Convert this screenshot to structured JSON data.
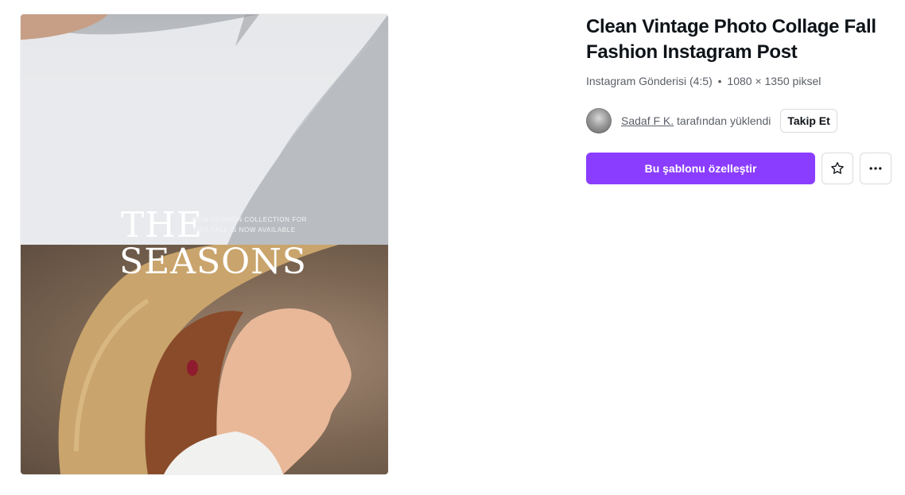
{
  "preview": {
    "image_top_description_icon": "white-hat-photo",
    "image_bottom_description_icon": "woman-straw-hat-photo",
    "title_line_1": "THE",
    "title_line_2": "SEASONS",
    "subline_1": "NEW FASHION COLLECTION FOR",
    "subline_2": "THIS FALL IS NOW AVAILABLE"
  },
  "details": {
    "title": "Clean Vintage Photo Collage Fall Fashion Instagram Post",
    "format": "Instagram Gönderisi (4:5)",
    "separator": "•",
    "dimensions": "1080 × 1350 piksel",
    "author_name": "Sadaf F K.",
    "uploaded_by_text": "tarafından yüklendi",
    "follow_label": "Takip Et",
    "customize_label": "Bu şablonu özelleştir",
    "favorite_icon": "star-icon",
    "more_icon": "more-horizontal-icon"
  },
  "colors": {
    "primary": "#8b3dff",
    "text": "#0e1318",
    "muted": "#5a5f66",
    "border": "#d9dbdd"
  }
}
